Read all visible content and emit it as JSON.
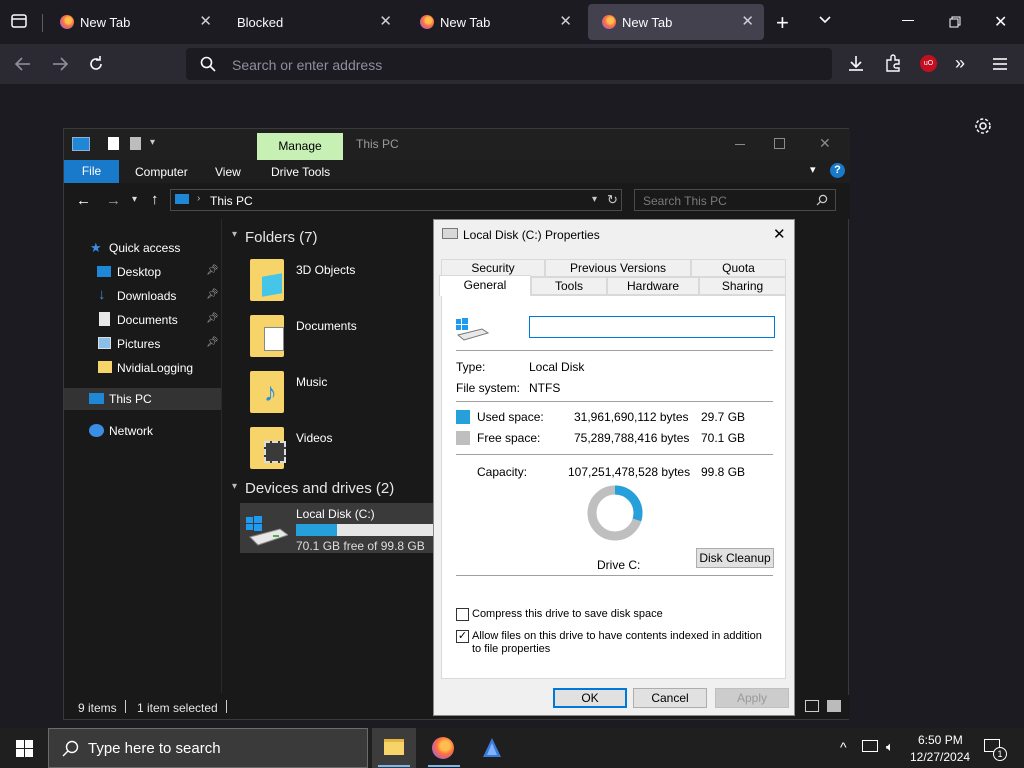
{
  "browser": {
    "tabs": [
      {
        "title": "New Tab",
        "icon": "firefox-icon"
      },
      {
        "title": "Blocked",
        "icon": ""
      },
      {
        "title": "New Tab",
        "icon": "firefox-icon"
      },
      {
        "title": "New Tab",
        "icon": "firefox-icon",
        "active": true
      }
    ],
    "address_placeholder": "Search or enter address"
  },
  "explorer": {
    "title_manage": "Manage",
    "title": "This PC",
    "ribbon": [
      "File",
      "Computer",
      "View",
      "Drive Tools"
    ],
    "address_path": "This PC",
    "search_placeholder": "Search This PC",
    "sidebar": {
      "quick_access": "Quick access",
      "items": [
        "Desktop",
        "Downloads",
        "Documents",
        "Pictures",
        "NvidiaLogging"
      ],
      "this_pc": "This PC",
      "network": "Network"
    },
    "folders_header": "Folders (7)",
    "folders": [
      "3D Objects",
      "Documents",
      "Music",
      "Videos"
    ],
    "devices_header": "Devices and drives (2)",
    "drive": {
      "name": "Local Disk (C:)",
      "free_text": "70.1 GB free of 99.8 GB",
      "used_fraction": 0.298
    },
    "status": {
      "items": "9 items",
      "selected": "1 item selected"
    }
  },
  "props": {
    "title": "Local Disk (C:) Properties",
    "tabs_top": [
      "Security",
      "Previous Versions",
      "Quota"
    ],
    "tabs_bottom": [
      "General",
      "Tools",
      "Hardware",
      "Sharing"
    ],
    "name_value": "",
    "type_label": "Type:",
    "type_value": "Local Disk",
    "fs_label": "File system:",
    "fs_value": "NTFS",
    "used_label": "Used space:",
    "used_bytes": "31,961,690,112 bytes",
    "used_gb": "29.7 GB",
    "free_label": "Free space:",
    "free_bytes": "75,289,788,416 bytes",
    "free_gb": "70.1 GB",
    "cap_label": "Capacity:",
    "cap_bytes": "107,251,478,528 bytes",
    "cap_gb": "99.8 GB",
    "drive_label": "Drive C:",
    "cleanup": "Disk Cleanup",
    "compress": "Compress this drive to save disk space",
    "index": "Allow files on this drive to have contents indexed in addition to file properties",
    "index_checked": true,
    "compress_checked": false,
    "ok": "OK",
    "cancel": "Cancel",
    "apply": "Apply",
    "colors": {
      "used": "#26a0da",
      "free": "#bfbfbf"
    }
  },
  "taskbar": {
    "search_placeholder": "Type here to search",
    "time": "6:50 PM",
    "date": "12/27/2024",
    "notifications": "1"
  }
}
